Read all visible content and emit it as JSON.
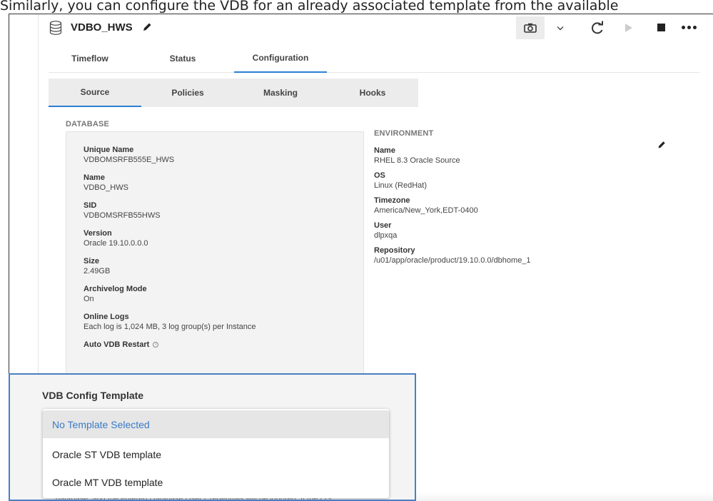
{
  "caption": "Similarly, you can configure the VDB for an already associated template from the available",
  "header": {
    "title": "VDBO_HWS",
    "icons": [
      "database-icon",
      "pencil-icon",
      "camera-icon",
      "chevron-down-icon",
      "refresh-icon",
      "play-icon",
      "stop-icon",
      "more-icon"
    ]
  },
  "tabs": {
    "timeflow": "Timeflow",
    "status": "Status",
    "configuration": "Configuration",
    "active": "Configuration"
  },
  "subtabs": {
    "source": "Source",
    "policies": "Policies",
    "masking": "Masking",
    "hooks": "Hooks",
    "active": "Source"
  },
  "database": {
    "section": "DATABASE",
    "fields": [
      {
        "label": "Unique Name",
        "value": "VDBOMSRFB555E_HWS"
      },
      {
        "label": "Name",
        "value": "VDBO_HWS"
      },
      {
        "label": "SID",
        "value": "VDBOMSRFB55HWS"
      },
      {
        "label": "Version",
        "value": "Oracle 19.10.0.0.0"
      },
      {
        "label": "Size",
        "value": "2.49GB"
      },
      {
        "label": "Archivelog Mode",
        "value": "On"
      },
      {
        "label": "Online Logs",
        "value": "Each log is 1,024 MB, 3 log group(s) per Instance"
      },
      {
        "label": "Auto VDB Restart",
        "value": ""
      }
    ]
  },
  "environment": {
    "section": "ENVIRONMENT",
    "fields": [
      {
        "label": "Name",
        "value": "RHEL 8.3 Oracle Source"
      },
      {
        "label": "OS",
        "value": "Linux (RedHat)"
      },
      {
        "label": "Timezone",
        "value": "America/New_York,EDT-0400"
      },
      {
        "label": "User",
        "value": "dlpxqa"
      },
      {
        "label": "Repository",
        "value": "/u01/app/oracle/product/19.10.0.0/dbhome_1"
      }
    ]
  },
  "template": {
    "label": "VDB Config Template",
    "selected": "No Template Selected",
    "options": [
      "No Template Selected",
      "Oracle ST VDB template",
      "Oracle MT VDB template"
    ],
    "under_text": "database, and the entered Database User Credentials will be ignored. If the OS"
  },
  "colors": {
    "accent": "#2a7fd4",
    "highlight_border": "#4a7fc1",
    "selected_text": "#3a7ac8"
  }
}
